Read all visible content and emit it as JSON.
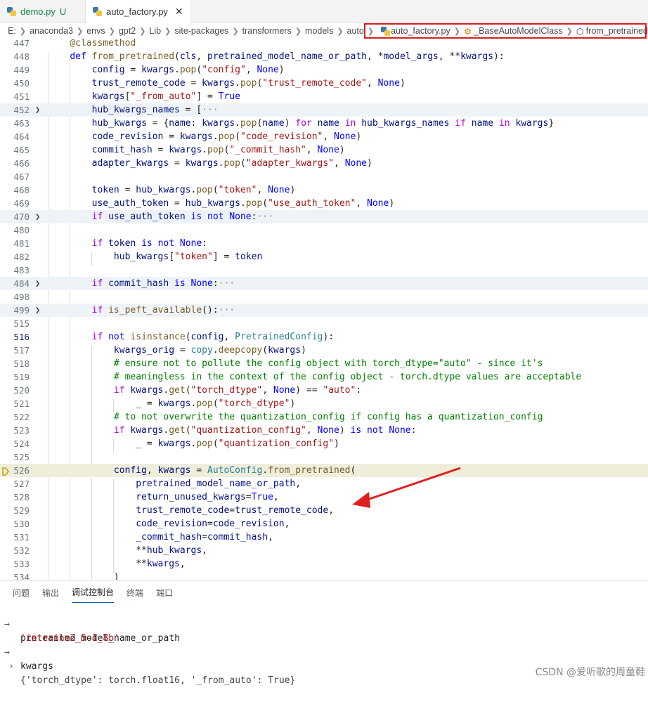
{
  "tabs": [
    {
      "label": "demo.py",
      "status": "U"
    },
    {
      "label": "auto_factory.py",
      "close": "✕"
    }
  ],
  "breadcrumb": {
    "path": [
      "E:",
      "anaconda3",
      "envs",
      "gpt2",
      "Lib",
      "site-packages",
      "transformers",
      "models",
      "auto"
    ],
    "file": "auto_factory.py",
    "class": "_BaseAutoModelClass",
    "method": "from_pretrained"
  },
  "editor": {
    "line_numbers": [
      "447",
      "448",
      "449",
      "450",
      "451",
      "452",
      "463",
      "464",
      "465",
      "466",
      "467",
      "468",
      "469",
      "470",
      "480",
      "481",
      "482",
      "483",
      "484",
      "498",
      "499",
      "515",
      "516",
      "517",
      "518",
      "519",
      "520",
      "521",
      "522",
      "523",
      "524",
      "525",
      "526",
      "527",
      "528",
      "529",
      "530",
      "531",
      "532",
      "533",
      "534"
    ],
    "current_line": "526"
  },
  "panel": {
    "tabs": [
      "问题",
      "输出",
      "调试控制台",
      "终端",
      "端口"
    ],
    "active_tab": "调试控制台",
    "entries": [
      {
        "marker": "→",
        "text": "pretrained_model_name_or_path"
      },
      {
        "marker": "",
        "text": "'internlm2_5-1_8b'"
      },
      {
        "marker": "→",
        "text": "kwargs"
      },
      {
        "marker": "›",
        "text": "{'torch_dtype': torch.float16, '_from_auto': True}"
      }
    ]
  },
  "watermark": "CSDN @爱听歌的周童鞋",
  "colors": {
    "highlight_box": "#d81e1e",
    "arrow": "#e02020",
    "current_line": "#eeeedb"
  }
}
